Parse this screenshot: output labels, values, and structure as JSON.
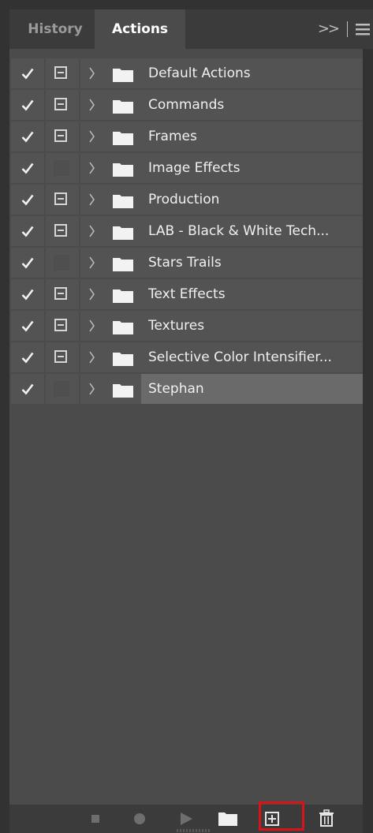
{
  "tabs": {
    "history_label": "History",
    "actions_label": "Actions",
    "collapse_glyph": ">>",
    "menu_icon": "hamburger-menu-icon"
  },
  "actions": [
    {
      "name": "Default Actions",
      "checked": true,
      "dialog": true
    },
    {
      "name": "Commands",
      "checked": true,
      "dialog": true
    },
    {
      "name": "Frames",
      "checked": true,
      "dialog": true
    },
    {
      "name": "Image Effects",
      "checked": true,
      "dialog": false
    },
    {
      "name": "Production",
      "checked": true,
      "dialog": true
    },
    {
      "name": "LAB - Black & White Tech...",
      "checked": true,
      "dialog": true
    },
    {
      "name": "Stars Trails",
      "checked": true,
      "dialog": false
    },
    {
      "name": "Text Effects",
      "checked": true,
      "dialog": true
    },
    {
      "name": "Textures",
      "checked": true,
      "dialog": true
    },
    {
      "name": "Selective Color Intensifier...",
      "checked": true,
      "dialog": true
    },
    {
      "name": "Stephan",
      "checked": true,
      "dialog": false,
      "selected": true
    }
  ],
  "toolbar": {
    "icons": [
      "stop-icon",
      "record-icon",
      "play-icon",
      "new-set-folder-icon",
      "new-action-icon",
      "trash-icon"
    ],
    "highlight_color": "#d8141b"
  },
  "colors": {
    "panel_bg": "#4b4b4b",
    "row_bg": "#535353",
    "selected_bg": "#6a6a6a",
    "text": "#f0f0f0"
  }
}
